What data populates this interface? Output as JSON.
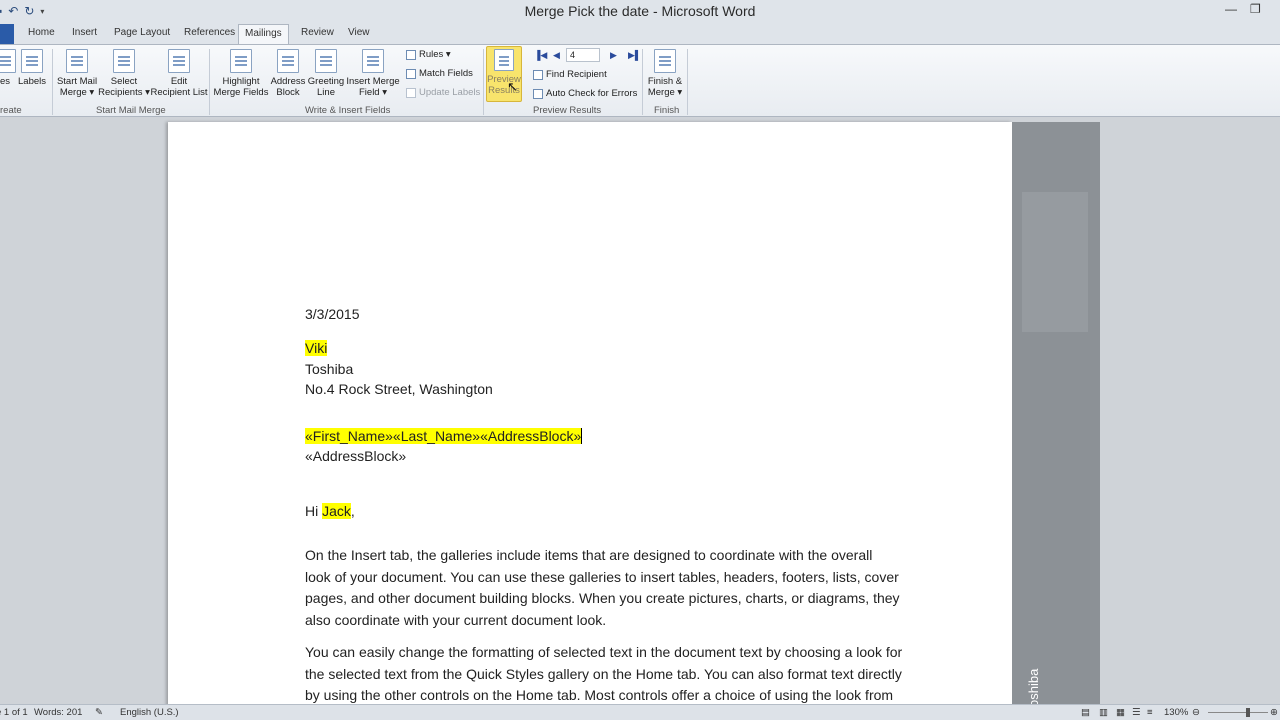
{
  "window": {
    "title": "Merge Pick the date  -  Microsoft Word"
  },
  "tabs": [
    "Home",
    "Insert",
    "Page Layout",
    "References",
    "Mailings",
    "Review",
    "View"
  ],
  "active_tab": "Mailings",
  "ribbon": {
    "create": {
      "labels_cut": "es",
      "labels": "Labels",
      "group": "reate"
    },
    "start_mail_merge": {
      "start_l1": "Start Mail",
      "start_l2": "Merge ▾",
      "select_l1": "Select",
      "select_l2": "Recipients ▾",
      "edit_l1": "Edit",
      "edit_l2": "Recipient List",
      "group": "Start Mail Merge"
    },
    "write_insert": {
      "highlight_l1": "Highlight",
      "highlight_l2": "Merge Fields",
      "address_l1": "Address",
      "address_l2": "Block",
      "greeting_l1": "Greeting",
      "greeting_l2": "Line",
      "insert_l1": "Insert Merge",
      "insert_l2": "Field ▾",
      "rules": "Rules ▾",
      "match": "Match Fields",
      "update": "Update Labels",
      "group": "Write & Insert Fields"
    },
    "preview": {
      "btn_l1": "Preview",
      "btn_l2": "Results",
      "record": "4",
      "find": "Find Recipient",
      "auto": "Auto Check for Errors",
      "group": "Preview Results"
    },
    "finish": {
      "l1": "Finish &",
      "l2": "Merge ▾",
      "group": "Finish"
    }
  },
  "document": {
    "date": "3/3/2015",
    "name": "Viki",
    "company": "Toshiba",
    "address": "No.4 Rock Street, Washington",
    "merge_line": "«First_Name»«Last_Name»«AddressBlock»",
    "address_block": "«AddressBlock»",
    "greeting_hi": "Hi ",
    "greeting_name": "Jack",
    "greeting_comma": ",",
    "para1": [
      "On the Insert tab, the galleries include items that are designed to coordinate with the overall",
      "look of your document. You can use these galleries to insert tables, headers, footers, lists, cover",
      "pages, and other document building blocks. When you create pictures, charts, or diagrams, they",
      "also coordinate with your current document look."
    ],
    "para2": [
      "You can easily change the formatting of selected text in the document text by choosing a look for",
      "the selected text from the Quick Styles gallery on the Home tab. You can also format text directly",
      "by using the other controls on the Home tab. Most controls offer a choice of using the look from"
    ],
    "sidebar_text": "oshiba"
  },
  "status": {
    "page": "e 1 of 1",
    "words": "Words: 201",
    "language": "English (U.S.)",
    "zoom": "130%"
  }
}
